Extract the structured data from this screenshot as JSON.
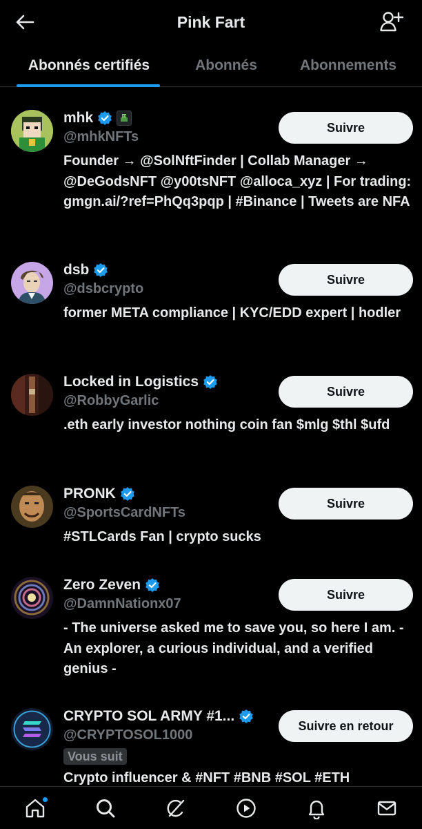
{
  "header": {
    "title": "Pink Fart"
  },
  "tabs": [
    {
      "label": "Abonnés certifiés",
      "active": true
    },
    {
      "label": "Abonnés",
      "active": false
    },
    {
      "label": "Abonnements",
      "active": false
    }
  ],
  "accounts": [
    {
      "name": "mhk",
      "handle": "@mhkNFTs",
      "bio": "Founder → @SolNftFinder | Collab Manager → @DeGodsNFT @y00tsNFT @alloca_xyz | For trading: gmgn.ai/?ref=PhQq3pqp | #Binance | Tweets are NFA",
      "button": "Suivre",
      "verified": true,
      "has_nft_badge": true
    },
    {
      "name": "dsb",
      "handle": "@dsbcrypto",
      "bio": "former META compliance | KYC/EDD expert | hodler",
      "button": "Suivre",
      "verified": true
    },
    {
      "name": "Locked in Logistics",
      "handle": "@RobbyGarlic",
      "bio": ".eth early investor nothing coin fan $mlg $thl $ufd",
      "button": "Suivre",
      "verified": true
    },
    {
      "name": "PRONK",
      "handle": "@SportsCardNFTs",
      "bio": "#STLCards Fan | crypto sucks",
      "button": "Suivre",
      "verified": true
    },
    {
      "name": "Zero Zeven",
      "handle": "@DamnNationx07",
      "bio": "- The universe asked me to save you, so here I am. - An explorer, a curious individual, and a verified genius -",
      "button": "Suivre",
      "verified": true
    },
    {
      "name": "CRYPTO SOL ARMY #1...",
      "handle": "@CRYPTOSOL1000",
      "follows_you": "Vous suit",
      "bio": "Crypto influencer & #NFT #BNB #SOL #ETH",
      "button": "Suivre en retour",
      "verified": true
    }
  ],
  "bottom_nav": [
    {
      "icon": "home-icon",
      "notification_dot": true
    },
    {
      "icon": "search-icon"
    },
    {
      "icon": "grok-icon"
    },
    {
      "icon": "play-icon"
    },
    {
      "icon": "bell-icon"
    },
    {
      "icon": "mail-icon"
    }
  ],
  "colors": {
    "background": "#000000",
    "text_primary": "#e7e9ea",
    "text_secondary": "#71767b",
    "accent": "#1d9bf0",
    "button_bg": "#eff3f4",
    "divider": "#2f3336"
  }
}
